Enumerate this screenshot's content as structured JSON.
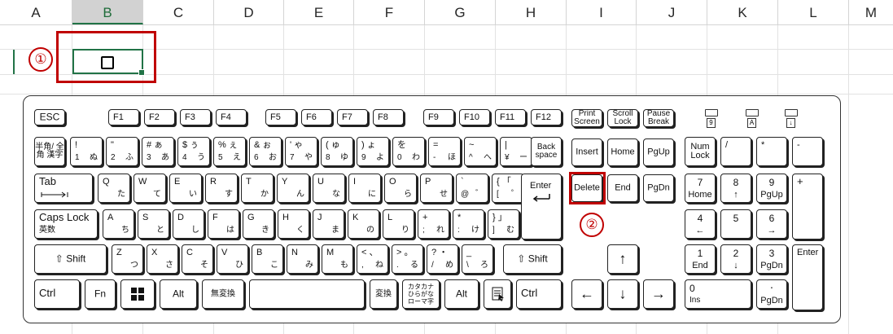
{
  "sheet": {
    "columns": [
      "A",
      "B",
      "C",
      "D",
      "E",
      "F",
      "G",
      "H",
      "I",
      "J",
      "K",
      "L",
      "M"
    ],
    "selected_column": "B",
    "cell_glyph": "□"
  },
  "annotations": {
    "marker1": "①",
    "marker2": "②",
    "highlight_color": "#c00000"
  },
  "keyboard": {
    "function_row": [
      "ESC",
      "F1",
      "F2",
      "F3",
      "F4",
      "F5",
      "F6",
      "F7",
      "F8",
      "F9",
      "F10",
      "F11",
      "F12"
    ],
    "print_screen": "Print Screen",
    "scroll_lock": "Scroll Lock",
    "pause_break": "Pause Break",
    "leds": [
      "9",
      "A",
      "↓"
    ],
    "number_row": {
      "hankaku": "半角/ 全角 漢字",
      "keys": [
        {
          "t": "!",
          "b": "1",
          "k": "ぬ"
        },
        {
          "t": "\"",
          "b": "2",
          "k": "ふ"
        },
        {
          "t": "# ぁ",
          "b": "3",
          "k": "あ"
        },
        {
          "t": "$ ぅ",
          "b": "4",
          "k": "う"
        },
        {
          "t": "% ぇ",
          "b": "5",
          "k": "え"
        },
        {
          "t": "& ぉ",
          "b": "6",
          "k": "お"
        },
        {
          "t": "' ゃ",
          "b": "7",
          "k": "や"
        },
        {
          "t": "( ゅ",
          "b": "8",
          "k": "ゆ"
        },
        {
          "t": ") ょ",
          "b": "9",
          "k": "よ"
        },
        {
          "t": "を",
          "b": "0",
          "k": "わ"
        },
        {
          "t": "=",
          "b": "-",
          "k": "ほ"
        },
        {
          "t": "~",
          "b": "^",
          "k": "へ"
        },
        {
          "t": "|",
          "b": "¥",
          "k": "ー"
        }
      ],
      "backspace": "Back space"
    },
    "qwerty_row": {
      "tab": "Tab",
      "keys": [
        {
          "t": "Q",
          "k": "た"
        },
        {
          "t": "W",
          "k": "て"
        },
        {
          "t": "E",
          "k": "い"
        },
        {
          "t": "R",
          "k": "す"
        },
        {
          "t": "T",
          "k": "か"
        },
        {
          "t": "Y",
          "k": "ん"
        },
        {
          "t": "U",
          "k": "な"
        },
        {
          "t": "I",
          "k": "に"
        },
        {
          "t": "O",
          "k": "ら"
        },
        {
          "t": "P",
          "k": "せ"
        },
        {
          "t": "`",
          "b": "@",
          "k": "゛"
        },
        {
          "t": "{ 「",
          "b": "[",
          "k": "゜"
        }
      ],
      "enter": "Enter"
    },
    "home_row": {
      "caps": "Caps Lock",
      "caps_sub": "英数",
      "keys": [
        {
          "t": "A",
          "k": "ち"
        },
        {
          "t": "S",
          "k": "と"
        },
        {
          "t": "D",
          "k": "し"
        },
        {
          "t": "F",
          "k": "は"
        },
        {
          "t": "G",
          "k": "き"
        },
        {
          "t": "H",
          "k": "く"
        },
        {
          "t": "J",
          "k": "ま"
        },
        {
          "t": "K",
          "k": "の"
        },
        {
          "t": "L",
          "k": "り"
        },
        {
          "t": "+",
          "b": ";",
          "k": "れ"
        },
        {
          "t": "*",
          "b": ":",
          "k": "け"
        },
        {
          "t": "} 」",
          "b": "]",
          "k": "む"
        }
      ]
    },
    "shift_row": {
      "shift": "Shift",
      "keys": [
        {
          "t": "Z",
          "k": "つ"
        },
        {
          "t": "X",
          "k": "さ"
        },
        {
          "t": "C",
          "k": "そ"
        },
        {
          "t": "V",
          "k": "ひ"
        },
        {
          "t": "B",
          "k": "こ"
        },
        {
          "t": "N",
          "k": "み"
        },
        {
          "t": "M",
          "k": "も"
        },
        {
          "t": "< 、",
          "b": ",",
          "k": "ね"
        },
        {
          "t": "> 。",
          "b": ".",
          "k": "る"
        },
        {
          "t": "? ・",
          "b": "/",
          "k": "め"
        },
        {
          "t": "_",
          "b": "\\",
          "k": "ろ"
        }
      ],
      "shift_right": "Shift"
    },
    "bottom_row": {
      "ctrl": "Ctrl",
      "fn": "Fn",
      "alt": "Alt",
      "muhenkan": "無変換",
      "henkan": "変換",
      "kana": "カタカナ ひらがな ローマ字",
      "alt_right": "Alt",
      "ctrl_right": "Ctrl"
    },
    "nav": {
      "insert": "Insert",
      "home": "Home",
      "pgup": "PgUp",
      "delete": "Delete",
      "end": "End",
      "pgdn": "PgDn",
      "up": "↑",
      "left": "←",
      "down": "↓",
      "right": "→"
    },
    "numpad": {
      "numlock": "Num Lock",
      "slash": "/",
      "star": "*",
      "minus": "-",
      "plus": "+",
      "enter": "Enter",
      "k7": "7",
      "k7s": "Home",
      "k8": "8",
      "k8s": "↑",
      "k9": "9",
      "k9s": "PgUp",
      "k4": "4",
      "k4s": "←",
      "k5": "5",
      "k6": "6",
      "k6s": "→",
      "k1": "1",
      "k1s": "End",
      "k2": "2",
      "k2s": "↓",
      "k3": "3",
      "k3s": "PgDn",
      "k0": "0",
      "k0s": "Ins",
      "dot": "·",
      "dots": "PgDn"
    }
  }
}
